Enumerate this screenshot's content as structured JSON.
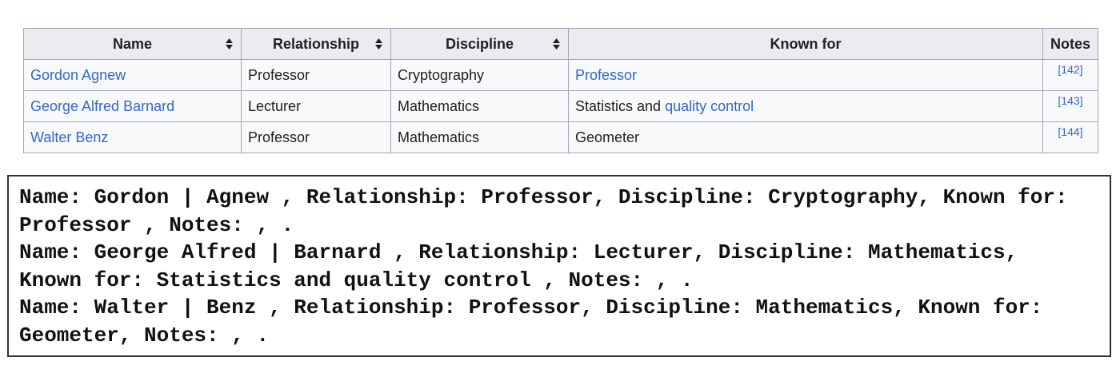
{
  "table": {
    "headers": [
      {
        "label": "Name",
        "sortable": true
      },
      {
        "label": "Relationship",
        "sortable": true
      },
      {
        "label": "Discipline",
        "sortable": true
      },
      {
        "label": "Known for",
        "sortable": false
      },
      {
        "label": "Notes",
        "sortable": false
      }
    ],
    "rows": [
      {
        "name": "Gordon Agnew",
        "relationship": "Professor",
        "discipline": "Cryptography",
        "known_for_plain": "",
        "known_for_link": "Professor",
        "notes": "[142]"
      },
      {
        "name": "George Alfred Barnard",
        "relationship": "Lecturer",
        "discipline": "Mathematics",
        "known_for_plain": "Statistics and ",
        "known_for_link": "quality control",
        "notes": "[143]"
      },
      {
        "name": "Walter Benz",
        "relationship": "Professor",
        "discipline": "Mathematics",
        "known_for_plain": "Geometer",
        "known_for_link": "",
        "notes": "[144]"
      }
    ]
  },
  "text_block": {
    "lines": [
      "Name: Gordon | Agnew , Relationship: Professor, Discipline: Cryptography, Known for:",
      "Professor , Notes: , .",
      "Name: George Alfred | Barnard , Relationship: Lecturer, Discipline: Mathematics,",
      "Known for: Statistics and quality control , Notes: , .",
      "Name: Walter | Benz , Relationship: Professor, Discipline: Mathematics, Known for:",
      "Geometer, Notes: , ."
    ]
  },
  "colors": {
    "link": "#3366cc",
    "header_bg": "#eaecf0",
    "cell_bg": "#f8f9fa",
    "border": "#a2a9b1"
  }
}
